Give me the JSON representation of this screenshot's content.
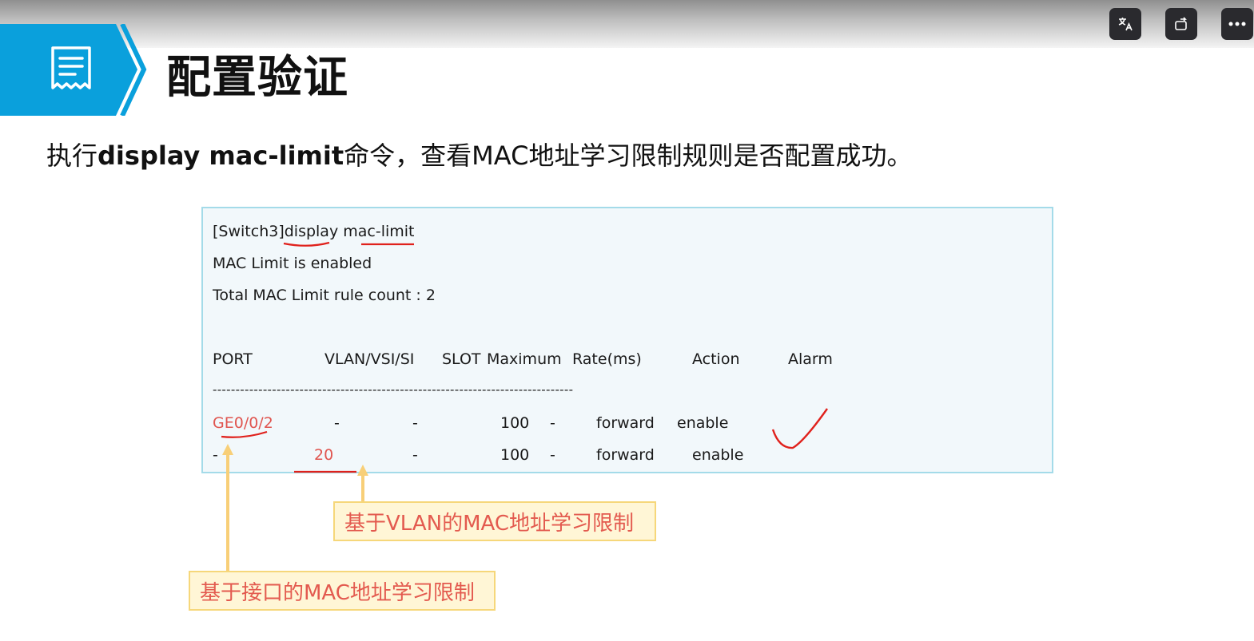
{
  "title": "配置验证",
  "subtitle": {
    "prefix": "执行",
    "command": "display mac-limit",
    "suffix": "命令，查看MAC地址学习限制规则是否配置成功。"
  },
  "toolbar": {
    "translate_icon": "translate-icon",
    "rotate_icon": "rotate-icon",
    "more_icon": "more-icon"
  },
  "terminal": {
    "prompt": "[Switch3]",
    "cmd_display": "display",
    "cmd_arg": "mac-limit",
    "status": "MAC Limit is enabled",
    "count": "Total MAC Limit rule count : 2",
    "headers": {
      "port": "PORT",
      "vlan": "VLAN/VSI/SI",
      "slot": "SLOT",
      "maximum": "Maximum",
      "rate": "Rate(ms)",
      "action": "Action",
      "alarm": "Alarm"
    },
    "separator": "-------------------------------------------------------------------------------",
    "rows": [
      {
        "port": "GE0/0/2",
        "vlan": "-",
        "slot": "-",
        "maximum": "100",
        "rate": "-",
        "action": "forward",
        "alarm": "enable"
      },
      {
        "port": "-",
        "vlan": "20",
        "slot": "-",
        "maximum": "100",
        "rate": "-",
        "action": "forward",
        "alarm": "enable"
      }
    ]
  },
  "callouts": {
    "vlan": "基于VLAN的MAC地址学习限制",
    "port": "基于接口的MAC地址学习限制"
  },
  "colors": {
    "banner_blue": "#0aa0dc",
    "highlight_red": "#e0554f",
    "callout_bg": "#fff6d6",
    "arrow": "#f8cf78"
  }
}
